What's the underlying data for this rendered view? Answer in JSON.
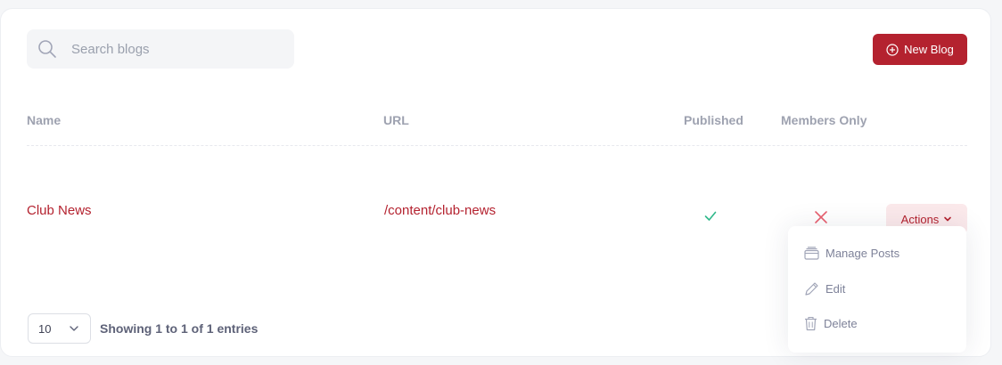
{
  "search": {
    "placeholder": "Search blogs"
  },
  "toolbar": {
    "new_blog_label": "New Blog"
  },
  "table": {
    "columns": [
      "Name",
      "URL",
      "Published",
      "Members Only"
    ],
    "rows": [
      {
        "name": "Club News",
        "url": "/content/club-news",
        "published": true,
        "members_only": false,
        "actions_label": "Actions"
      }
    ]
  },
  "actions_menu": {
    "items": [
      {
        "label": "Manage Posts",
        "icon": "archive-icon"
      },
      {
        "label": "Edit",
        "icon": "pencil-icon"
      },
      {
        "label": "Delete",
        "icon": "trash-icon"
      }
    ]
  },
  "pagination": {
    "page_size": "10",
    "summary": "Showing 1 to 1 of 1 entries"
  },
  "colors": {
    "brand": "#b4222f",
    "brand_light": "#fbe9eb",
    "success": "#2fb88a",
    "danger": "#e8606f"
  }
}
